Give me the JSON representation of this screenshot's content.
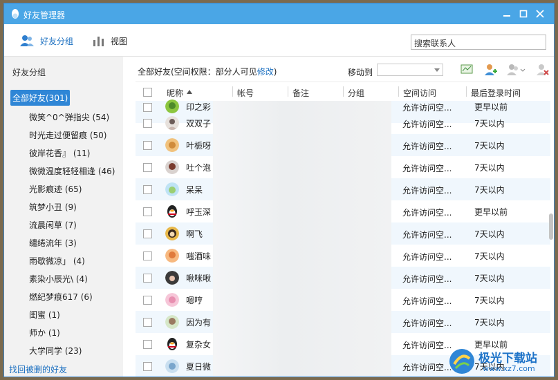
{
  "window": {
    "title": "好友管理器"
  },
  "toolbar": {
    "tabs": [
      {
        "label": "好友分组",
        "icon": "friends-icon"
      },
      {
        "label": "视图",
        "icon": "chart-icon"
      }
    ],
    "search_placeholder": "搜索联系人"
  },
  "sidebar": {
    "title": "好友分组",
    "groups": [
      "全部好友(301)",
      "微笑^0^弹指尖 (54)",
      "时光走过便留痕 (50)",
      "彼岸花香』 (11)",
      "微微温度轻轻相逢 (46)",
      "光影痕迹 (65)",
      "筑梦小丑 (9)",
      "流晨闲草 (7)",
      "缱绻流年 (3)",
      "雨歇微凉」 (4)",
      "素染小辰光\\ (4)",
      "燃纪梦痕617 (6)",
      "闺蜜 (1)",
      "师か (1)",
      "大学同学 (23)"
    ],
    "footer_link": "找回被删的好友"
  },
  "main": {
    "scope_prefix": "全部好友(空间权限：部分人可见",
    "modify_link": "修改",
    "scope_suffix": ")",
    "move_to_label": "移动到",
    "move_to_value": ""
  },
  "table": {
    "columns": {
      "nickname": "昵称",
      "account": "帐号",
      "note": "备注",
      "group": "分组",
      "space_access": "空间访问",
      "last_login": "最后登录时间"
    },
    "rows": [
      {
        "nickname": "印之彩",
        "access": "允许访问空...",
        "last": "更早以前"
      },
      {
        "nickname": "双双子",
        "access": "允许访问空...",
        "last": "7天以内"
      },
      {
        "nickname": "叶栀呀",
        "access": "允许访问空...",
        "last": "7天以内"
      },
      {
        "nickname": "吐个泡",
        "access": "允许访问空...",
        "last": "7天以内"
      },
      {
        "nickname": "呆呆",
        "access": "允许访问空...",
        "last": "7天以内"
      },
      {
        "nickname": "呼玉深",
        "access": "允许访问空...",
        "last": "更早以前"
      },
      {
        "nickname": "啊飞",
        "access": "允许访问空...",
        "last": "7天以内"
      },
      {
        "nickname": "嗤酒味",
        "access": "允许访问空...",
        "last": "7天以内"
      },
      {
        "nickname": "啾咪啾",
        "access": "允许访问空...",
        "last": "7天以内"
      },
      {
        "nickname": "嗯哼",
        "access": "允许访问空...",
        "last": "7天以内"
      },
      {
        "nickname": "因为有",
        "access": "允许访问空...",
        "last": "7天以内"
      },
      {
        "nickname": "复杂女",
        "access": "允许访问空...",
        "last": "更早以前"
      },
      {
        "nickname": "夏日微",
        "access": "允许访问空...",
        "last": "7天以内"
      }
    ]
  },
  "watermark": {
    "name": "极光下载站",
    "url": "www.xz7.com"
  }
}
